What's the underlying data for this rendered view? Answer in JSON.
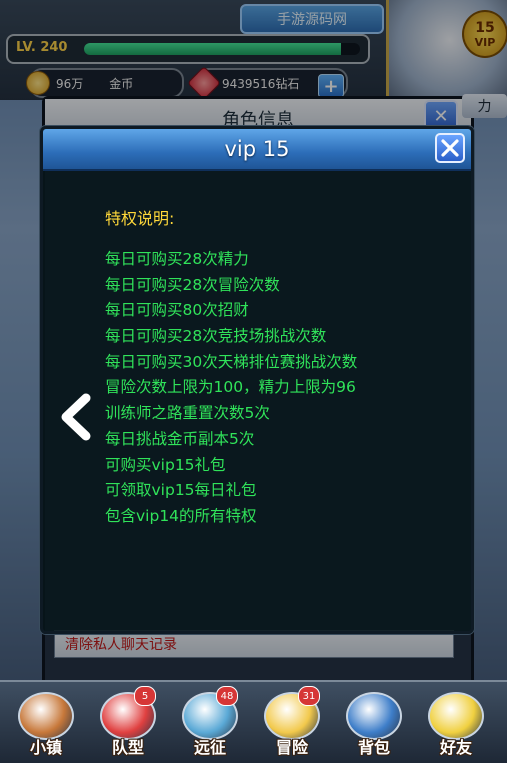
{
  "hud": {
    "site_tag": "手游源码网",
    "level": "LV. 240",
    "exp_fraction": 0.93,
    "gold": "96万",
    "gold_label": "金币",
    "gems": "9439516钻石",
    "vip_label": "VIP",
    "vip_level": "15"
  },
  "background_panel": {
    "title": "角色信息",
    "power_btn": "力",
    "clear_chat": "清除私人聊天记录"
  },
  "dialog": {
    "title": "vip 15",
    "section_title": "特权说明:",
    "perks": [
      "每日可购买28次精力",
      "每日可购买28次冒险次数",
      "每日可购买80次招财",
      "每日可购买28次竞技场挑战次数",
      "每日可购买30次天梯排位赛挑战次数",
      "冒险次数上限为100，精力上限为96",
      "训练师之路重置次数5次",
      "每日挑战金币副本5次",
      "可购买vip15礼包",
      "可领取vip15每日礼包",
      "包含vip14的所有特权"
    ]
  },
  "bottom_nav": [
    {
      "label": "小镇",
      "badge": "",
      "color": "#c7783a"
    },
    {
      "label": "队型",
      "badge": "5",
      "color": "#e04040"
    },
    {
      "label": "远征",
      "badge": "48",
      "color": "#5aa9d6"
    },
    {
      "label": "冒险",
      "badge": "31",
      "color": "#f2c94c"
    },
    {
      "label": "背包",
      "badge": "",
      "color": "#3e7ec9"
    },
    {
      "label": "好友",
      "badge": "",
      "color": "#f0d040"
    }
  ]
}
